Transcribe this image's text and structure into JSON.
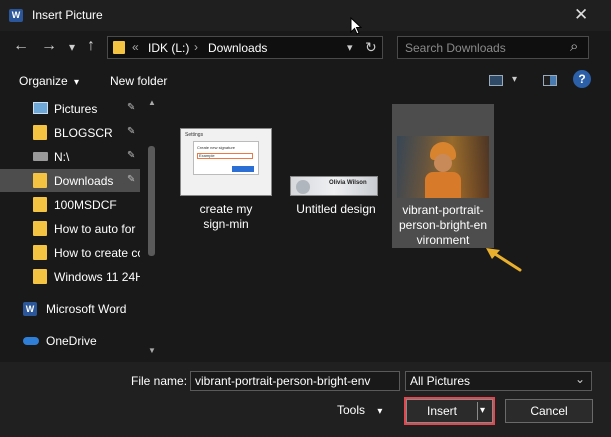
{
  "window": {
    "title": "Insert Picture",
    "app_icon_letter": "W",
    "close_glyph": "✕"
  },
  "nav": {
    "back_icon": "←",
    "forward_icon": "→",
    "dropdown_icon": "▾",
    "up_icon": "↑",
    "breadcrumb": {
      "overflow": "«",
      "drive": "IDK (L:)",
      "separator": "›",
      "folder": "Downloads",
      "dropdown_icon": "▾",
      "refresh_icon": "↻"
    },
    "search_placeholder": "Search Downloads",
    "search_icon": "⌕"
  },
  "toolbar": {
    "organize_label": "Organize",
    "organize_caret": "▾",
    "new_folder_label": "New folder",
    "view_caret": "▾",
    "help_icon": "?"
  },
  "sidebar": {
    "items": [
      {
        "label": "Pictures",
        "icon": "pictures-icon",
        "pinned": true
      },
      {
        "label": "BLOGSCR",
        "icon": "folder-icon",
        "pinned": true
      },
      {
        "label": "N:\\",
        "icon": "network-drive-icon",
        "pinned": true
      },
      {
        "label": "Downloads",
        "icon": "folder-icon",
        "pinned": true,
        "selected": true
      },
      {
        "label": "100MSDCF",
        "icon": "folder-icon",
        "pinned": false
      },
      {
        "label": "How to auto for",
        "icon": "folder-icon",
        "pinned": false
      },
      {
        "label": "How to create co",
        "icon": "folder-icon",
        "pinned": false
      },
      {
        "label": "Windows 11 24H",
        "icon": "folder-icon",
        "pinned": false
      },
      {
        "label": "Microsoft Word",
        "icon": "word-icon",
        "pinned": false
      },
      {
        "label": "OneDrive",
        "icon": "onedrive-icon",
        "pinned": false
      }
    ],
    "pin_glyph": "📌"
  },
  "files": [
    {
      "caption_line1": "create my",
      "caption_line2": "sign-min"
    },
    {
      "caption_line1": "Untitled design",
      "thumbnail_text": "Olivia Wilson"
    },
    {
      "caption_line1": "vibrant-portrait-",
      "caption_line2": "person-bright-en",
      "caption_line3": "vironment",
      "selected": true
    }
  ],
  "thumb1": {
    "header": "Settings",
    "dialog_title": "Create new signature",
    "field_value": "Example"
  },
  "bottom": {
    "file_name_label": "File name:",
    "file_name_value": "vibrant-portrait-person-bright-env",
    "file_type_value": "All Pictures",
    "tools_label": "Tools",
    "tools_caret": "▾",
    "insert_label": "Insert",
    "insert_caret": "▾",
    "cancel_label": "Cancel",
    "combo_caret": "⌄"
  },
  "colors": {
    "accent_highlight": "#e0484f",
    "arrow_color": "#e8b02d",
    "folder_yellow": "#f5c342",
    "selection_bg": "#4d4d4d"
  }
}
